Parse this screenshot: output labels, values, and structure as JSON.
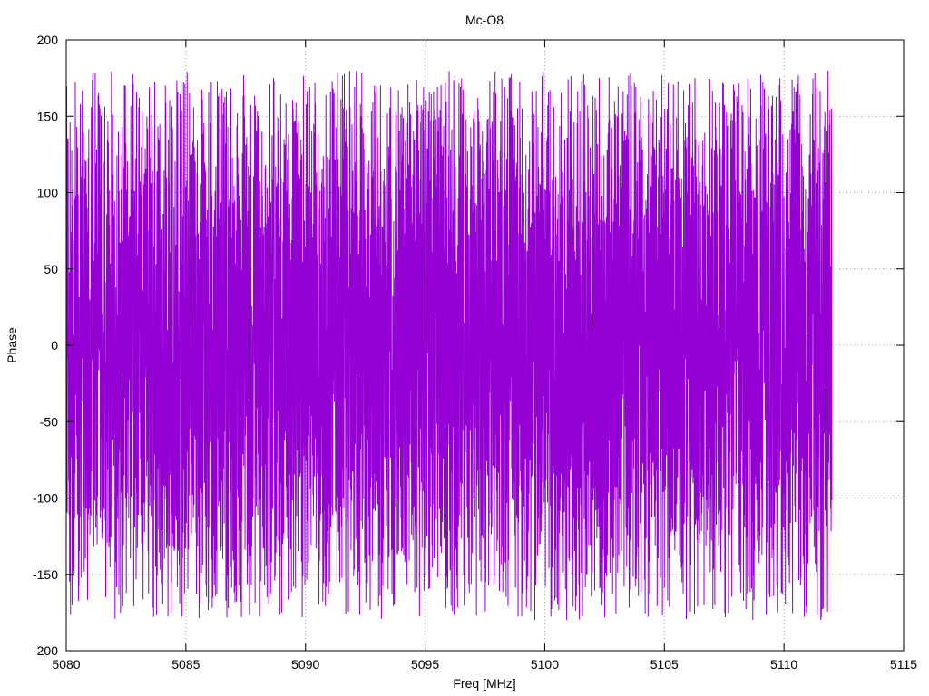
{
  "chart_data": {
    "type": "line",
    "title": "Mc-O8",
    "xlabel": "Freq [MHz]",
    "ylabel": "Phase",
    "xlim": [
      5080,
      5115
    ],
    "ylim": [
      -200,
      200
    ],
    "xticks": [
      5080,
      5085,
      5090,
      5095,
      5100,
      5105,
      5110,
      5115
    ],
    "yticks": [
      -200,
      -150,
      -100,
      -50,
      0,
      50,
      100,
      150,
      200
    ],
    "grid": true,
    "legend": "none",
    "series": [
      {
        "color": "#9400D3",
        "x_range": [
          5080,
          5112
        ],
        "approx_point_count": 3200,
        "value_range": [
          -180,
          180
        ],
        "description_of_values": "phase wraps rapidly between about -180 and +180 degrees"
      }
    ]
  }
}
